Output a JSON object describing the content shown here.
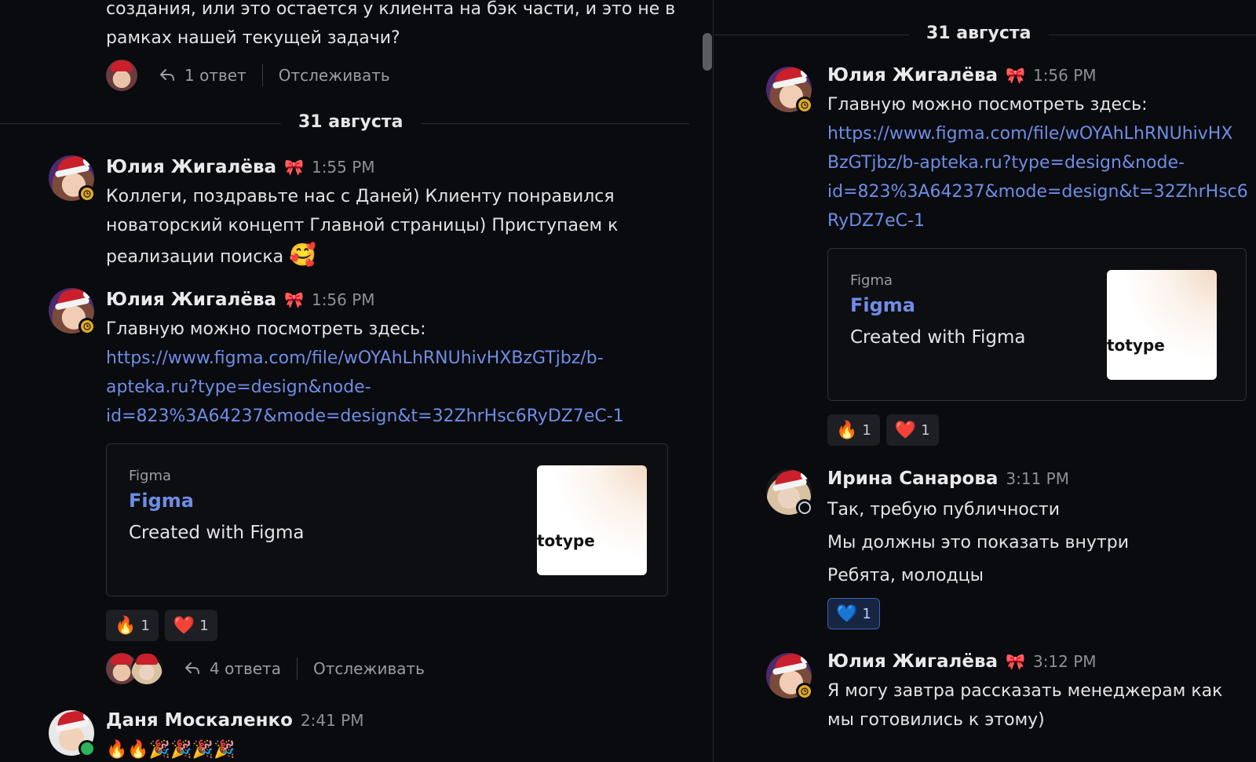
{
  "left": {
    "top_message": {
      "text_lines": [
        "создания, или это остается у клиента на бэк части, и это не в",
        "рамках нашей текущей задачи?"
      ],
      "thread": {
        "reply_count": "1 ответ",
        "follow": "Отслеживать"
      }
    },
    "date_separator": "31 августа",
    "messages": [
      {
        "author": "Юлия Жигалёва",
        "author_emoji": "🎀",
        "time": "1:55 PM",
        "text_lines": [
          "Коллеги, поздравьте нас с Даней) Клиенту понравился",
          "новаторский концепт Главной страницы) Приступаем к",
          "реализации поиска"
        ],
        "trailing_emoji": "🥰"
      },
      {
        "author": "Юлия Жигалёва",
        "author_emoji": "🎀",
        "time": "1:56 PM",
        "text": "Главную можно посмотреть здесь:",
        "link_lines": [
          "https://www.figma.com/file/wOYAhLhRNUhivHXBzGTjbz/b-",
          "apteka.ru?type=design&node-",
          "id=823%3A64237&mode=design&t=32ZhrHsc6RyDZ7eC-1"
        ],
        "embed": {
          "site": "Figma",
          "title": "Figma",
          "description": "Created with Figma",
          "thumb_text": "totype"
        },
        "reactions": [
          {
            "emoji": "🔥",
            "count": "1"
          },
          {
            "emoji": "❤️",
            "count": "1"
          }
        ],
        "thread": {
          "reply_count": "4 ответа",
          "follow": "Отслеживать"
        }
      },
      {
        "author": "Даня Москаленко",
        "time": "2:41 PM",
        "text": "🔥🔥🎉🎉🎉🎉"
      }
    ]
  },
  "right": {
    "date_separator": "31 августа",
    "messages": [
      {
        "author": "Юлия Жигалёва",
        "author_emoji": "🎀",
        "time": "1:56 PM",
        "text": "Главную можно посмотреть здесь:",
        "link_lines": [
          "https://www.figma.com/file/wOYAhLhRNUhivHX",
          "BzGTjbz/b-apteka.ru?type=design&node-",
          "id=823%3A64237&mode=design&t=32ZhrHsc6",
          "RyDZ7eC-1"
        ],
        "embed": {
          "site": "Figma",
          "title": "Figma",
          "description": "Created with Figma",
          "thumb_text": "totype"
        },
        "reactions": [
          {
            "emoji": "🔥",
            "count": "1"
          },
          {
            "emoji": "❤️",
            "count": "1"
          }
        ]
      },
      {
        "author": "Ирина Санарова",
        "time": "3:11 PM",
        "lines": [
          "Так, требую публичности",
          "Мы должны это показать внутри",
          "Ребята, молодцы"
        ],
        "reactions": [
          {
            "emoji": "💙",
            "count": "1"
          }
        ]
      },
      {
        "author": "Юлия Жигалёва",
        "author_emoji": "🎀",
        "time": "3:12 PM",
        "text_lines": [
          "Я могу завтра рассказать менеджерам как",
          "мы готовились к этому)"
        ]
      }
    ]
  },
  "colors": {
    "background": "#0a0b0e",
    "link": "#6e8de6",
    "status_away": "#e3a92a",
    "reaction_mine_border": "#3d63b3"
  },
  "icons": [
    "reply-arrow-icon",
    "clock-status-icon",
    "offline-status-icon",
    "online-status-icon"
  ]
}
